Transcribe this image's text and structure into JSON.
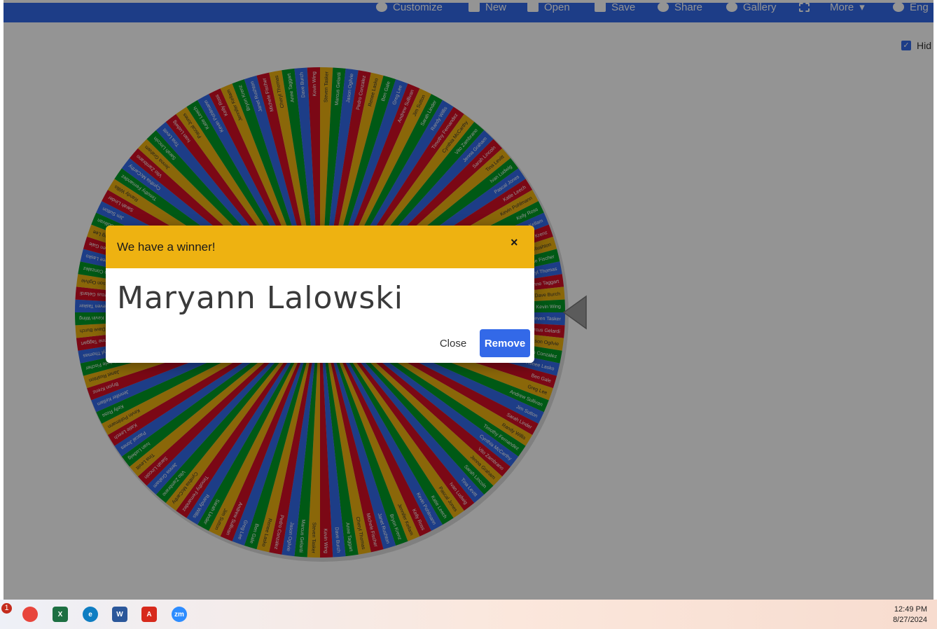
{
  "toolbar": {
    "items": [
      {
        "label": "Customize",
        "icon": "palette-icon"
      },
      {
        "label": "New",
        "icon": "file-icon"
      },
      {
        "label": "Open",
        "icon": "folder-icon"
      },
      {
        "label": "Save",
        "icon": "save-icon"
      },
      {
        "label": "Share",
        "icon": "share-icon"
      },
      {
        "label": "Gallery",
        "icon": "search-icon"
      },
      {
        "label": "",
        "icon": "fullscreen-icon"
      },
      {
        "label": "More",
        "icon": "chevron-down-icon"
      },
      {
        "label": "Eng",
        "icon": "globe-icon"
      }
    ]
  },
  "sidebar": {
    "hide_label": "Hid",
    "hide_checked": true
  },
  "wheel": {
    "colors": [
      "#3369e8",
      "#d50f25",
      "#eeb211",
      "#009925"
    ],
    "pointer_color": "#9e9e9e",
    "names": [
      "Steven Tasker",
      "Marcus Gelardi",
      "Jason Ogilvie",
      "Pedro Conzalez",
      "Renee Lasko",
      "Ben Gale",
      "Greg Lee",
      "Andrew Sullivan",
      "Jim Sutton",
      "Sarah Linder",
      "Randy Willis",
      "Timothy Fernandez",
      "Cynthia McCarthy",
      "Vito Zambrano",
      "Jenna Graham",
      "Sarah Lincoln",
      "Tina Levitt",
      "Ivan Ludwig",
      "Pascal Jones",
      "Katie Leech",
      "Kevin Pohlmann",
      "Kelly Ross",
      "Jennifer Kellam",
      "Bryon Krenz",
      "Janet Rushton",
      "Michele Fischer",
      "Cheryl Thomas",
      "Anne Taggart",
      "Dave Burch",
      "Kevin Wing"
    ],
    "winner_index": 3
  },
  "modal": {
    "header": "We have a winner!",
    "close_icon": "×",
    "winner": "Maryann Lalowski",
    "close_label": "Close",
    "remove_label": "Remove",
    "header_color": "#eeb211",
    "remove_color": "#3369e8"
  },
  "taskbar": {
    "badge_count": "1",
    "apps": [
      {
        "name": "chrome-icon",
        "label": "",
        "color": "#e8453c"
      },
      {
        "name": "excel-icon",
        "label": "X",
        "color": "#1d6f42"
      },
      {
        "name": "edge-icon",
        "label": "e",
        "color": "#0f7dc2"
      },
      {
        "name": "word-icon",
        "label": "W",
        "color": "#2b579a"
      },
      {
        "name": "acrobat-icon",
        "label": "A",
        "color": "#d7291c"
      },
      {
        "name": "zoom-icon",
        "label": "zm",
        "color": "#2d8cff"
      }
    ],
    "time": "12:49 PM",
    "date": "8/27/2024"
  }
}
